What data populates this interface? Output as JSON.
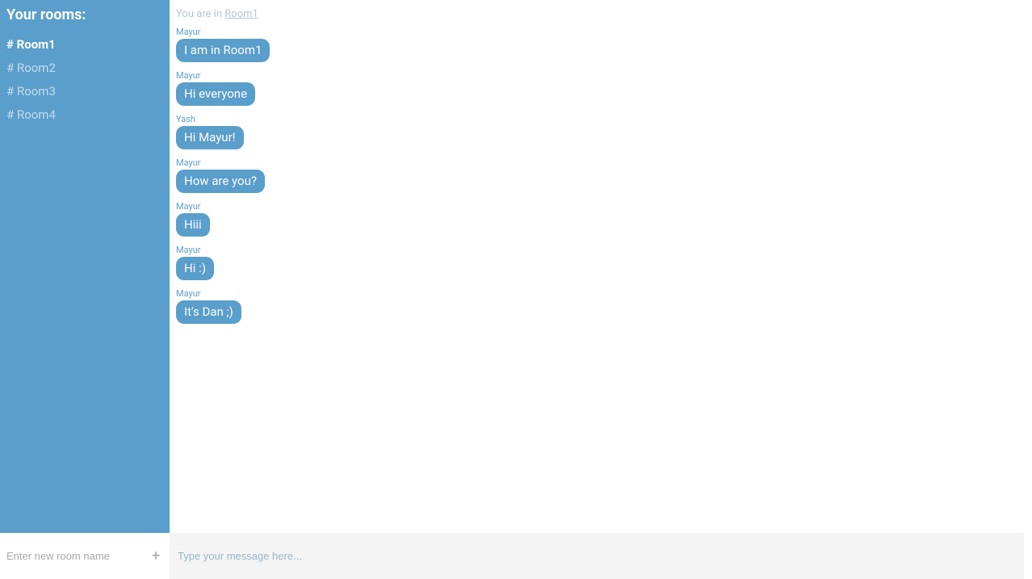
{
  "sidebar": {
    "title": "Your rooms:",
    "rooms": [
      {
        "label": "# Room1",
        "active": true
      },
      {
        "label": "# Room2",
        "active": false
      },
      {
        "label": "# Room3",
        "active": false
      },
      {
        "label": "# Room4",
        "active": false
      }
    ],
    "new_room_placeholder": "Enter new room name",
    "add_icon": "+"
  },
  "header": {
    "prefix": "You are in ",
    "room_link": "Room1"
  },
  "messages": [
    {
      "sender": "Mayur",
      "text": "I am in Room1"
    },
    {
      "sender": "Mayur",
      "text": "Hi everyone"
    },
    {
      "sender": "Yash",
      "text": "Hi Mayur!"
    },
    {
      "sender": "Mayur",
      "text": "How are you?"
    },
    {
      "sender": "Mayur",
      "text": "Hiii"
    },
    {
      "sender": "Mayur",
      "text": "Hi :)"
    },
    {
      "sender": "Mayur",
      "text": "It's Dan ;)"
    }
  ],
  "composer": {
    "placeholder": "Type your message here..."
  }
}
